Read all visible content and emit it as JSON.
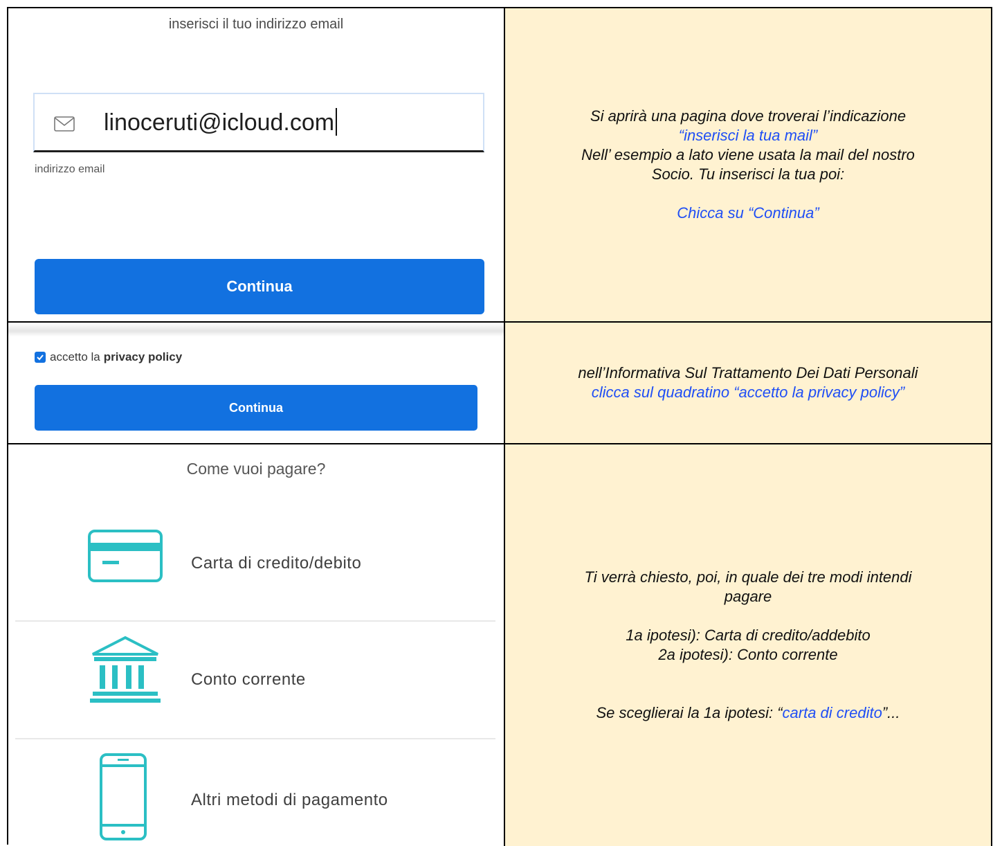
{
  "row1": {
    "heading": "inserisci il tuo indirizzo email",
    "email_value": "linoceruti@icloud.com",
    "email_caption": "indirizzo email",
    "button_label": "Continua",
    "instructions": {
      "line1": "Si aprirà una pagina dove troverai l’indicazione",
      "line2_open_quote": "“",
      "line2_link": "inserisci la tua mail",
      "line2_close_quote": "”",
      "line3": "Nell’ esempio a lato viene usata la mail del nostro",
      "line4": "Socio. Tu inserisci la tua poi:",
      "line5": "Chicca su “Continua”"
    }
  },
  "row2": {
    "checkbox_label": "accetto la",
    "checkbox_label_bold": "privacy policy",
    "checkbox_checked": true,
    "button_label": "Continua",
    "instructions": {
      "line1": "nell’Informativa Sul Trattamento Dei Dati Personali",
      "line2": "clicca sul quadratino “accetto la privacy policy”"
    }
  },
  "row3": {
    "heading": "Come vuoi pagare?",
    "payment_methods": [
      {
        "label": "Carta di credito/debito",
        "icon": "credit-card-icon"
      },
      {
        "label": "Conto corrente",
        "icon": "bank-icon"
      },
      {
        "label": "Altri metodi di pagamento",
        "icon": "smartphone-icon"
      }
    ],
    "instructions": {
      "line1": "Ti verrà chiesto, poi, in quale dei tre modi intendi",
      "line2": "pagare",
      "line3": "1a ipotesi): Carta di credito/addebito",
      "line4": "2a ipotesi): Conto corrente",
      "line5_prefix": "Se sceglierai la 1a ipotesi: “",
      "line5_link": "carta di credito",
      "line5_suffix": "”..."
    }
  },
  "colors": {
    "button_blue": "#1271e0",
    "icon_teal": "#2bbfc4",
    "instruction_bg": "#fff2d1",
    "link_blue": "#1f4ef5"
  }
}
